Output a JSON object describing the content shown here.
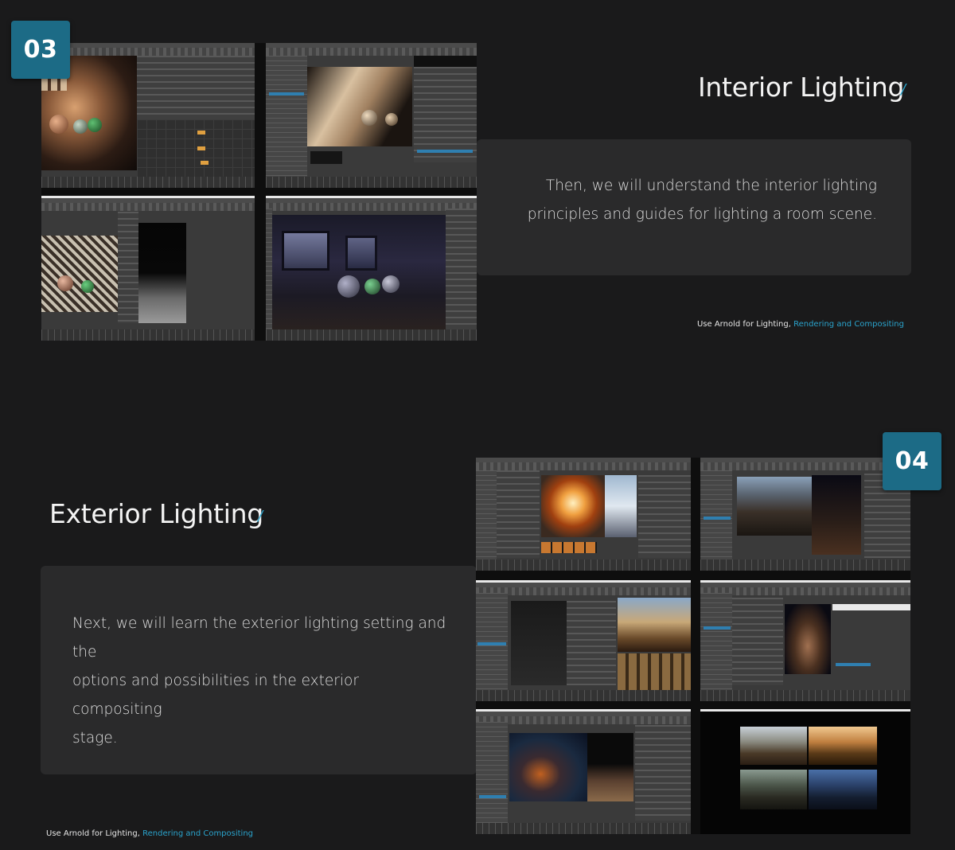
{
  "sections": [
    {
      "number": "03",
      "title": "Interior Lighting",
      "slash": "/",
      "description_lines": [
        "Then, we will understand the interior lighting",
        "principles and guides for lighting a room scene."
      ],
      "caption": {
        "prefix": "Use Arnold for Lighting, ",
        "link": "Rendering and Compositing"
      }
    },
    {
      "number": "04",
      "title": "Exterior Lighting",
      "slash": "/",
      "description_lines": [
        "Next, we will learn the exterior lighting setting and the",
        "options and possibilities in the exterior compositing",
        "stage."
      ],
      "caption": {
        "prefix": "Use Arnold for Lighting, ",
        "link": "Rendering and Compositing"
      }
    }
  ],
  "colors": {
    "background": "#1a1a1b",
    "accent": "#2aa3cc",
    "badge": "#1c6b86",
    "box": "#2a2a2b"
  },
  "screenshots": [
    {
      "section": "03",
      "content": "interior spheres render with node editor"
    },
    {
      "section": "03",
      "content": "dark room spheres lit from window"
    },
    {
      "section": "03",
      "content": "spheres on patterned floor"
    },
    {
      "section": "03",
      "content": "dark room interior render"
    },
    {
      "section": "04",
      "content": "explosion render"
    },
    {
      "section": "04",
      "content": "village street render"
    },
    {
      "section": "04",
      "content": "wireframe scene with village render"
    },
    {
      "section": "04",
      "content": "smoke render"
    },
    {
      "section": "04",
      "content": "night village render"
    },
    {
      "section": "04",
      "content": "four lighting variations of village"
    }
  ]
}
